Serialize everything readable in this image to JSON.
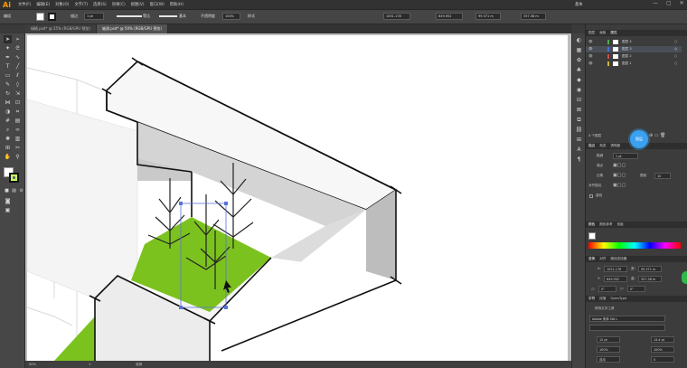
{
  "app": {
    "logo": "Ai"
  },
  "menubar": {
    "items": [
      "文件(F)",
      "编辑(E)",
      "对象(O)",
      "文字(T)",
      "选择(S)",
      "效果(C)",
      "视图(V)",
      "窗口(W)",
      "帮助(H)"
    ],
    "workspace": "基本",
    "window_controls": [
      "—",
      "▢",
      "✕"
    ]
  },
  "control_bar": {
    "selection_label": "编组",
    "stroke_label": "描边",
    "stroke_weight": "1 pt",
    "profile_label": "等比",
    "brush_label": "基本",
    "opacity_label": "不透明度",
    "opacity_value": "100%",
    "style_label": "样式",
    "x_value": "1051.178",
    "y_value": "649.952",
    "w_value": "99.371 m",
    "h_value": "357.38 m"
  },
  "tabs": [
    {
      "label": "绿植.psd* @ 25% (RGB/GPU 预览)",
      "active": false
    },
    {
      "label": "轴测.psd* @ 50% (RGB/GPU 预览)",
      "active": true
    }
  ],
  "layers_panel": {
    "tabs": [
      "图层",
      "画板",
      "属性"
    ],
    "layers": [
      {
        "name": "图层 4",
        "selected": false,
        "color": "#4caf50"
      },
      {
        "name": "图层 3",
        "selected": true,
        "color": "#4a6fd6"
      },
      {
        "name": "图层 2",
        "selected": false,
        "color": "#d24b4b"
      },
      {
        "name": "图层 1",
        "selected": false,
        "color": "#c8b93a"
      }
    ],
    "footer_count": "4 个图层"
  },
  "help_bubble": {
    "label": "图层"
  },
  "stroke_panel": {
    "tabs": [
      "描边",
      "渐变",
      "透明度"
    ],
    "weight_label": "粗细",
    "weight_value": "1 pt",
    "cap_label": "端点",
    "corner_label": "边角",
    "limit_label": "限制",
    "limit_value": "10",
    "align_label": "对齐描边",
    "dashed_label": "虚线"
  },
  "color_panel": {
    "tabs": [
      "颜色",
      "颜色参考",
      "色板"
    ]
  },
  "transform_panel": {
    "tabs": [
      "变换",
      "对齐",
      "路径查找器"
    ],
    "x_label": "X:",
    "x_value": "1051.178",
    "y_label": "Y:",
    "y_value": "649.952",
    "w_label": "宽:",
    "w_value": "99.371 m",
    "h_label": "高:",
    "h_value": "357.38 m",
    "rot_label": "△:",
    "rot_value": "0°",
    "shear_label": "◇:",
    "shear_value": "0°"
  },
  "character_panel": {
    "tabs": [
      "字符",
      "段落",
      "OpenType"
    ],
    "touch_type": "修饰文字工具",
    "font_name": "Adobe 宋体 Std L",
    "size_value": "12 pt",
    "leading_value": "14.4 pt",
    "scale_h_value": "100%",
    "scale_v_value": "100%",
    "tracking_value": "0",
    "kerning_value": "自动"
  },
  "status_bar": {
    "zoom": "50%",
    "page": "1",
    "tool": "选择"
  }
}
